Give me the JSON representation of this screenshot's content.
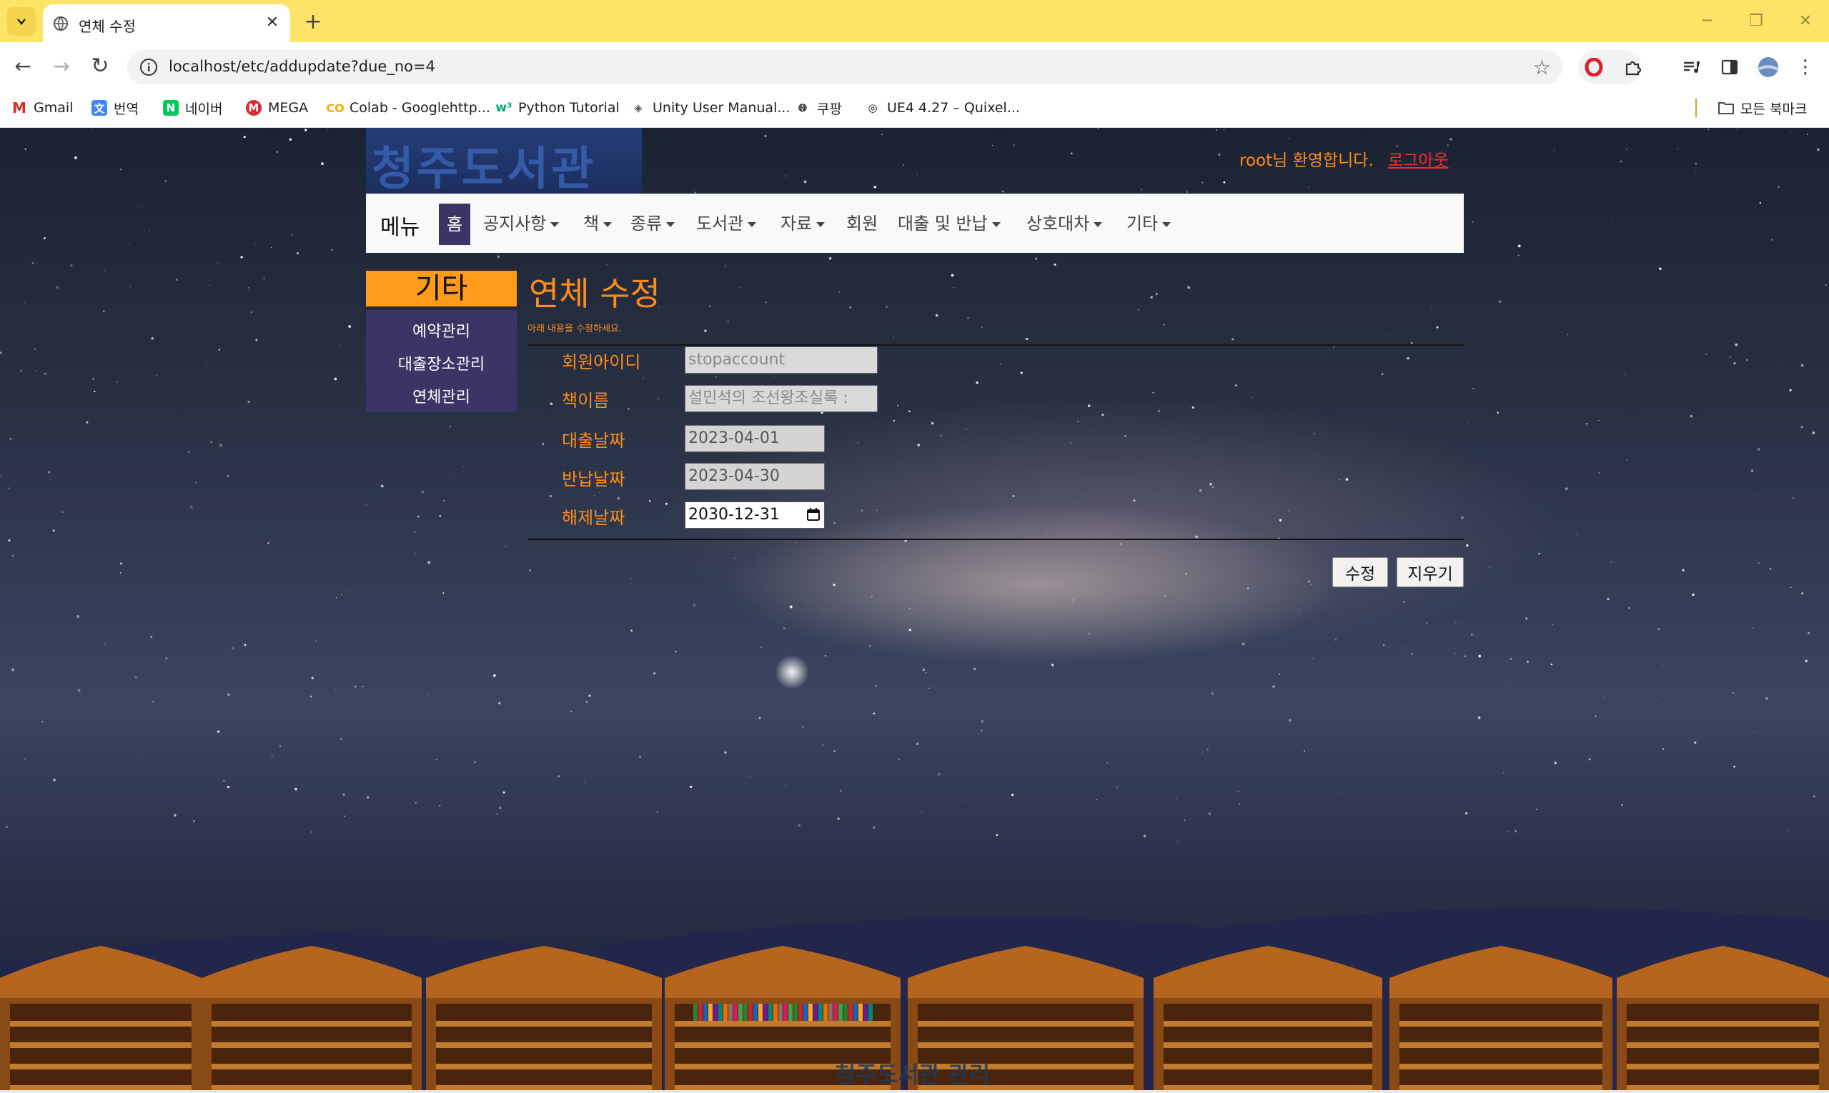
{
  "browser": {
    "tab_title": "연체 수정",
    "url": "localhost/etc/addupdate?due_no=4",
    "bookmarks": [
      "Gmail",
      "번역",
      "네이버",
      "MEGA",
      "Colab - Googlehttp...",
      "Python Tutorial",
      "Unity User Manual...",
      "쿠팡",
      "UE4 4.27 – Quixel..."
    ],
    "all_bookmarks": "모든 북마크"
  },
  "header": {
    "logo_text": "청주도서관",
    "welcome": "root님 환영합니다.",
    "logout": "로그아웃"
  },
  "menu": {
    "brand": "메뉴",
    "items": [
      "홈",
      "공지사항",
      "책",
      "종류",
      "도서관",
      "자료",
      "회원",
      "대출 및 반납",
      "상호대차",
      "기타"
    ],
    "active": "홈"
  },
  "sidebar": {
    "title": "기타",
    "items": [
      "예약관리",
      "대출장소관리",
      "연체관리"
    ]
  },
  "form": {
    "title": "연체 수정",
    "subtitle": "아래 내용을 수정하세요.",
    "fields": [
      {
        "label": "회원아이디",
        "value": "stopaccount"
      },
      {
        "label": "책이름",
        "value": "설민석의 조선왕조실록 :"
      },
      {
        "label": "대출날짜",
        "value": "2023-04-01"
      },
      {
        "label": "반납날짜",
        "value": "2023-04-30"
      },
      {
        "label": "해제날짜",
        "value": "2030-12-31"
      }
    ],
    "submit": "수정",
    "reset": "지우기"
  },
  "footer": {
    "text": "청주도서관 관리"
  },
  "colors": {
    "accent_orange": "#ff8c1a",
    "nav_active": "#3a3564",
    "tabstrip": "#fde366"
  }
}
